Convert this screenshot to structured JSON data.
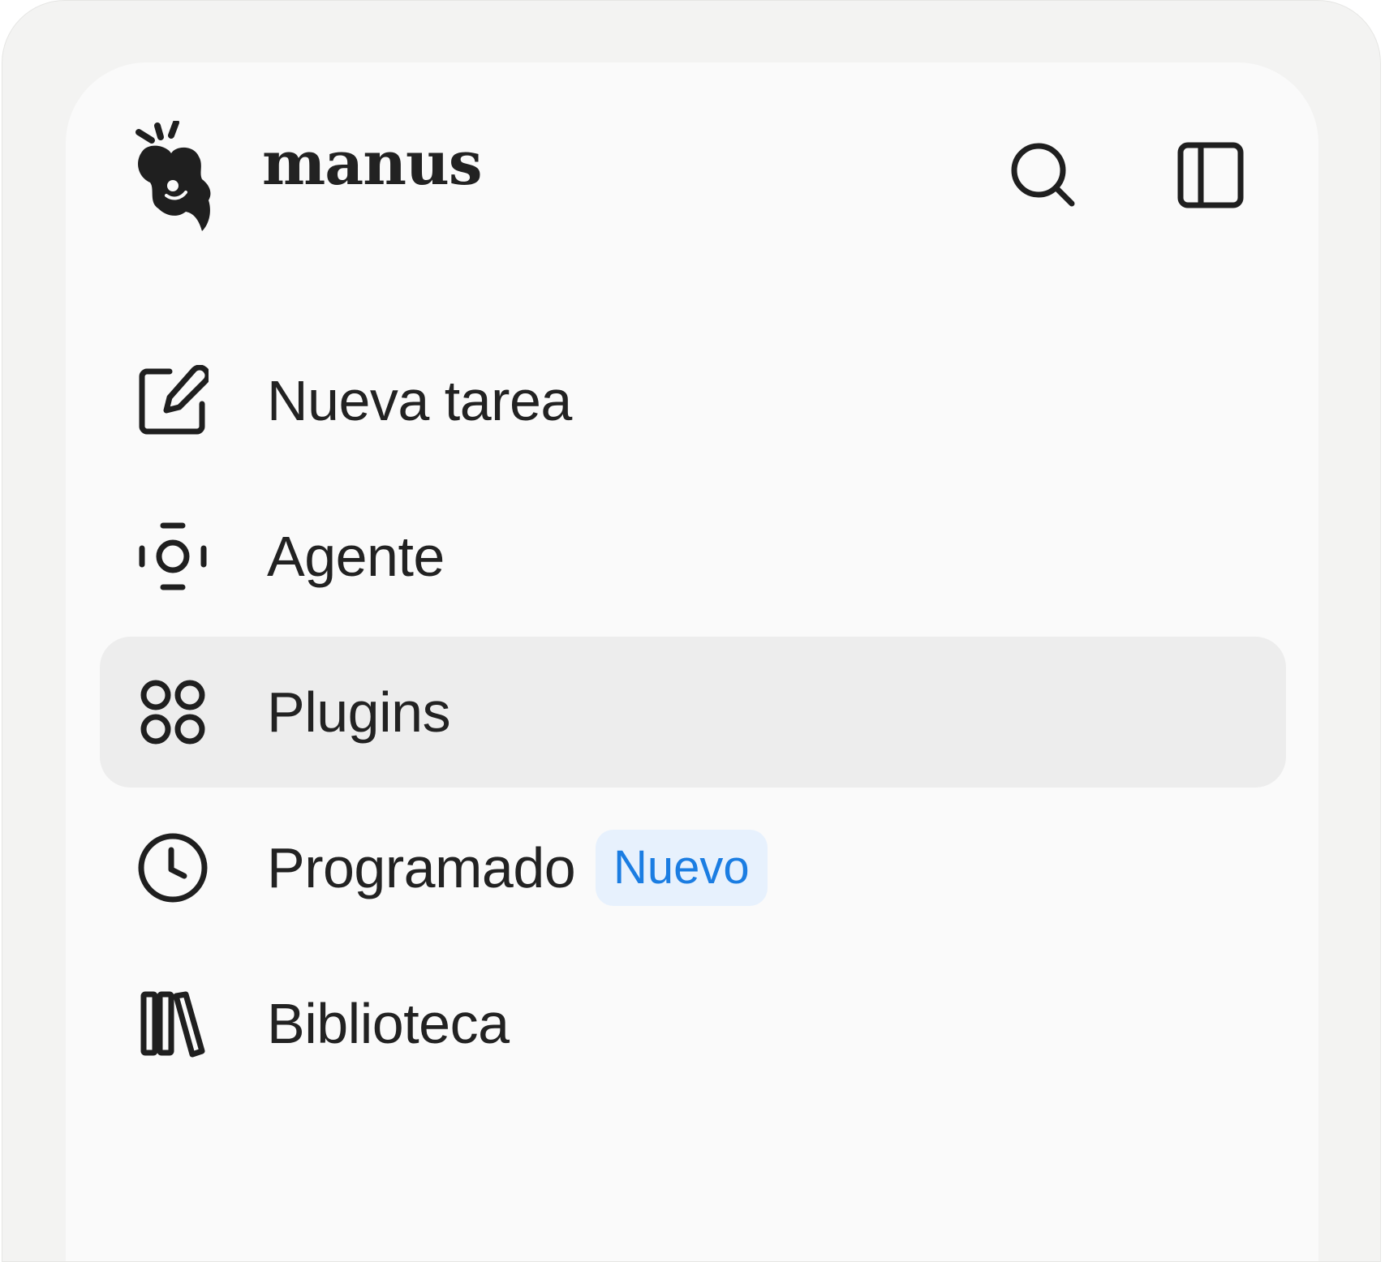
{
  "app": {
    "name": "manus"
  },
  "header": {
    "icons": [
      "manus-logo",
      "search-icon",
      "sidebar-toggle-icon"
    ]
  },
  "nav": {
    "items": [
      {
        "label": "Nueva tarea",
        "icon": "edit-icon",
        "active": false
      },
      {
        "label": "Agente",
        "icon": "agent-icon",
        "active": false
      },
      {
        "label": "Plugins",
        "icon": "grid-circles-icon",
        "active": true
      },
      {
        "label": "Programado",
        "icon": "clock-icon",
        "active": false,
        "badge": "Nuevo"
      },
      {
        "label": "Biblioteca",
        "icon": "library-icon",
        "active": false
      }
    ]
  },
  "colors": {
    "active_background": "#ededed",
    "badge_background": "#e7f1fd",
    "badge_text": "#1b7de2"
  }
}
